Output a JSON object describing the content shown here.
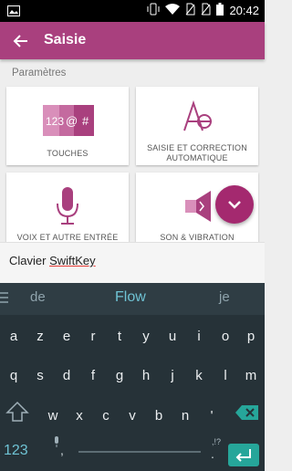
{
  "status_bar": {
    "time": "20:42",
    "icons": [
      "image-icon",
      "vibrate-icon",
      "wifi-icon",
      "no-sim-icon",
      "no-sim-icon",
      "battery-icon"
    ]
  },
  "app_bar": {
    "title": "Saisie",
    "back_icon": "arrow-back-icon"
  },
  "section": {
    "title": "Paramètres"
  },
  "cards": [
    {
      "label": "TOUCHES",
      "icon": "keys-icon"
    },
    {
      "label": "SAISIE ET CORRECTION AUTOMATIQUE",
      "icon": "typing-correction-icon"
    },
    {
      "label": "VOIX ET AUTRE ENTRÉE",
      "icon": "microphone-icon"
    },
    {
      "label": "SON & VIBRATION",
      "icon": "speaker-icon"
    }
  ],
  "fab": {
    "icon": "chevron-down-icon"
  },
  "text_field": {
    "prefix": "Clavier ",
    "word": "SwiftKey"
  },
  "keyboard": {
    "suggestions": [
      "de",
      "Flow",
      "je"
    ],
    "row1": [
      "a",
      "z",
      "e",
      "r",
      "t",
      "y",
      "u",
      "i",
      "o",
      "p"
    ],
    "row2": [
      "q",
      "s",
      "d",
      "f",
      "g",
      "h",
      "j",
      "k",
      "l",
      "m"
    ],
    "row3": [
      "w",
      "x",
      "c",
      "v",
      "b",
      "n",
      "'"
    ],
    "numbers_key": "123",
    "comma_key": ",",
    "period_key": ".",
    "punct_hint": ",!?",
    "icons": [
      "menu-icon",
      "shift-icon",
      "backspace-icon",
      "mic-icon",
      "enter-icon"
    ]
  },
  "colors": {
    "accent": "#a9407e",
    "fab": "#a4296f",
    "keyboard_bg": "#263238",
    "keyboard_accent": "#26a69a"
  }
}
